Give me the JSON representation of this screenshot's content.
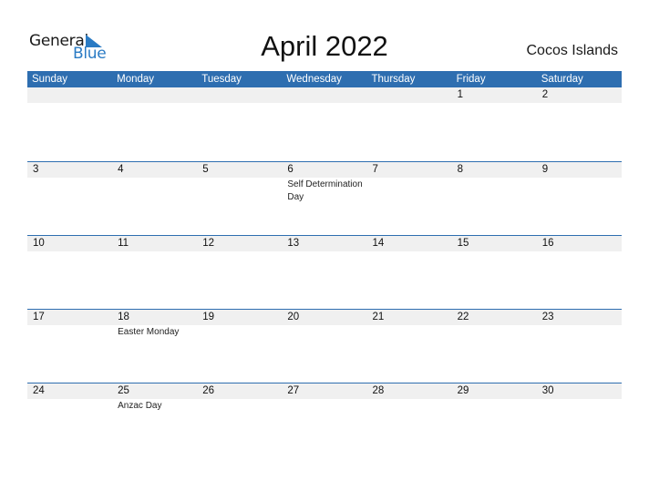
{
  "logo": {
    "word1": "General",
    "word2": "Blue"
  },
  "title": "April 2022",
  "country": "Cocos Islands",
  "colors": {
    "accent": "#2e6eb0",
    "strip": "#f0f0f0",
    "logo_blue": "#2a7bc4"
  },
  "weekdays": [
    "Sunday",
    "Monday",
    "Tuesday",
    "Wednesday",
    "Thursday",
    "Friday",
    "Saturday"
  ],
  "weeks": [
    {
      "days": [
        "",
        "",
        "",
        "",
        "",
        "1",
        "2"
      ],
      "events": [
        "",
        "",
        "",
        "",
        "",
        "",
        ""
      ]
    },
    {
      "days": [
        "3",
        "4",
        "5",
        "6",
        "7",
        "8",
        "9"
      ],
      "events": [
        "",
        "",
        "",
        "Self Determination Day",
        "",
        "",
        ""
      ]
    },
    {
      "days": [
        "10",
        "11",
        "12",
        "13",
        "14",
        "15",
        "16"
      ],
      "events": [
        "",
        "",
        "",
        "",
        "",
        "",
        ""
      ]
    },
    {
      "days": [
        "17",
        "18",
        "19",
        "20",
        "21",
        "22",
        "23"
      ],
      "events": [
        "",
        "Easter Monday",
        "",
        "",
        "",
        "",
        ""
      ]
    },
    {
      "days": [
        "24",
        "25",
        "26",
        "27",
        "28",
        "29",
        "30"
      ],
      "events": [
        "",
        "Anzac Day",
        "",
        "",
        "",
        "",
        ""
      ]
    }
  ]
}
